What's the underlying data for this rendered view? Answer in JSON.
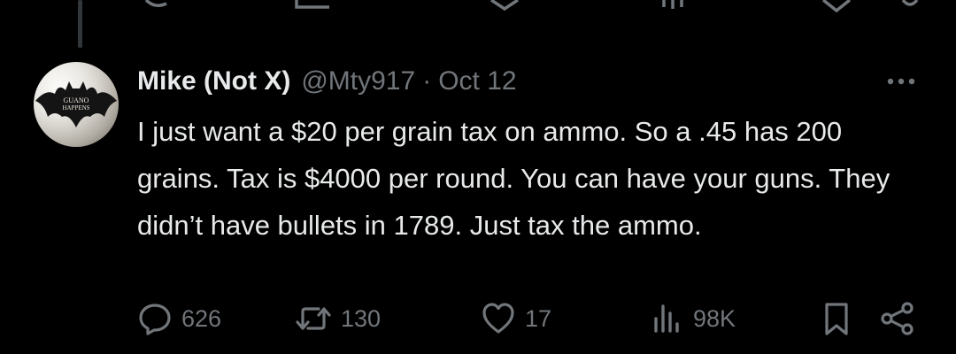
{
  "colors": {
    "background": "#000000",
    "primary_text": "#e7e9ea",
    "secondary_text": "#71767b",
    "thread_line": "#333639"
  },
  "tweet": {
    "display_name": "Mike (Not X)",
    "handle": "@Mty917",
    "separator": "·",
    "date": "Oct 12",
    "text": "I just want a $20 per grain tax on ammo. So a .45 has 200 grains. Tax is $4000 per round. You can have your guns. They didn’t have bullets in 1789. Just tax the ammo.",
    "avatar_text": "GUANO HAPPENS"
  },
  "actions": {
    "replies": "626",
    "reposts": "130",
    "likes": "17",
    "views": "98K"
  },
  "icons": {
    "reply": "reply-icon",
    "repost": "repost-icon",
    "like": "heart-icon",
    "views": "views-icon",
    "bookmark": "bookmark-icon",
    "share": "share-icon",
    "more": "more-icon"
  }
}
